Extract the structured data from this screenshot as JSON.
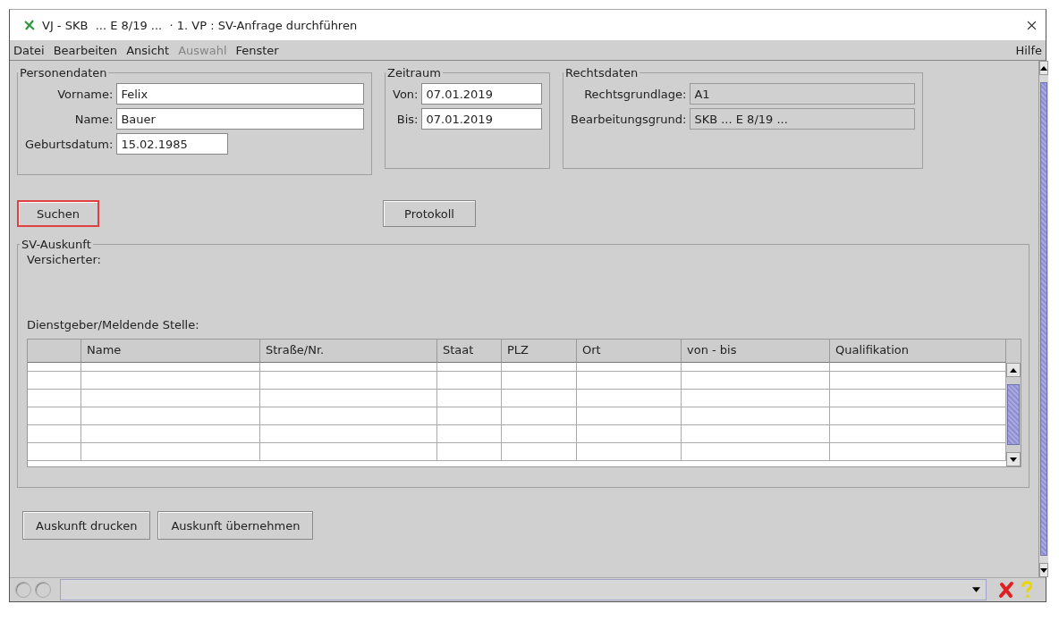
{
  "window": {
    "title": "VJ - SKB  ... E 8/19 ...  · 1. VP : SV-Anfrage durchführen"
  },
  "menu": [
    {
      "label": "Datei",
      "disabled": false
    },
    {
      "label": "Bearbeiten",
      "disabled": false
    },
    {
      "label": "Ansicht",
      "disabled": false
    },
    {
      "label": "Auswahl",
      "disabled": true
    },
    {
      "label": "Fenster",
      "disabled": false
    }
  ],
  "help_menu": "Hilfe",
  "groups": [
    {
      "title": "Personendaten",
      "kind": "person",
      "fields": [
        {
          "label": "Vorname:",
          "value": "Felix",
          "editable": true
        },
        {
          "label": "Name:",
          "value": "Bauer",
          "editable": true
        },
        {
          "label": "Geburtsdatum:",
          "value": "15.02.1985",
          "editable": true
        }
      ]
    },
    {
      "title": "Zeitraum",
      "kind": "period",
      "fields": [
        {
          "label": "Von:",
          "value": "07.01.2019",
          "editable": true
        },
        {
          "label": "Bis:",
          "value": "07.01.2019",
          "editable": true
        }
      ]
    },
    {
      "title": "Rechtsdaten",
      "kind": "legal",
      "fields": [
        {
          "label": "Rechtsgrundlage:",
          "value": "A1",
          "editable": false
        },
        {
          "label": "Bearbeitungsgrund:",
          "value": "SKB ... E 8/19 ...",
          "editable": false
        }
      ]
    }
  ],
  "search_button": {
    "label": "Suchen",
    "highlighted": true
  },
  "protocol_button": {
    "label": "Protokoll"
  },
  "result": {
    "title": "SV-Auskunft",
    "insured_label": "Versicherter:",
    "employer_label": "Dienstgeber/Meldende Stelle:",
    "table": {
      "columns": [
        "Name",
        "Straße/Nr.",
        "Staat",
        "PLZ",
        "Ort",
        "von - bis",
        "Qualifikation"
      ]
    }
  },
  "buttons": [
    "Auskunft drucken",
    "Auskunft übernehmen"
  ]
}
